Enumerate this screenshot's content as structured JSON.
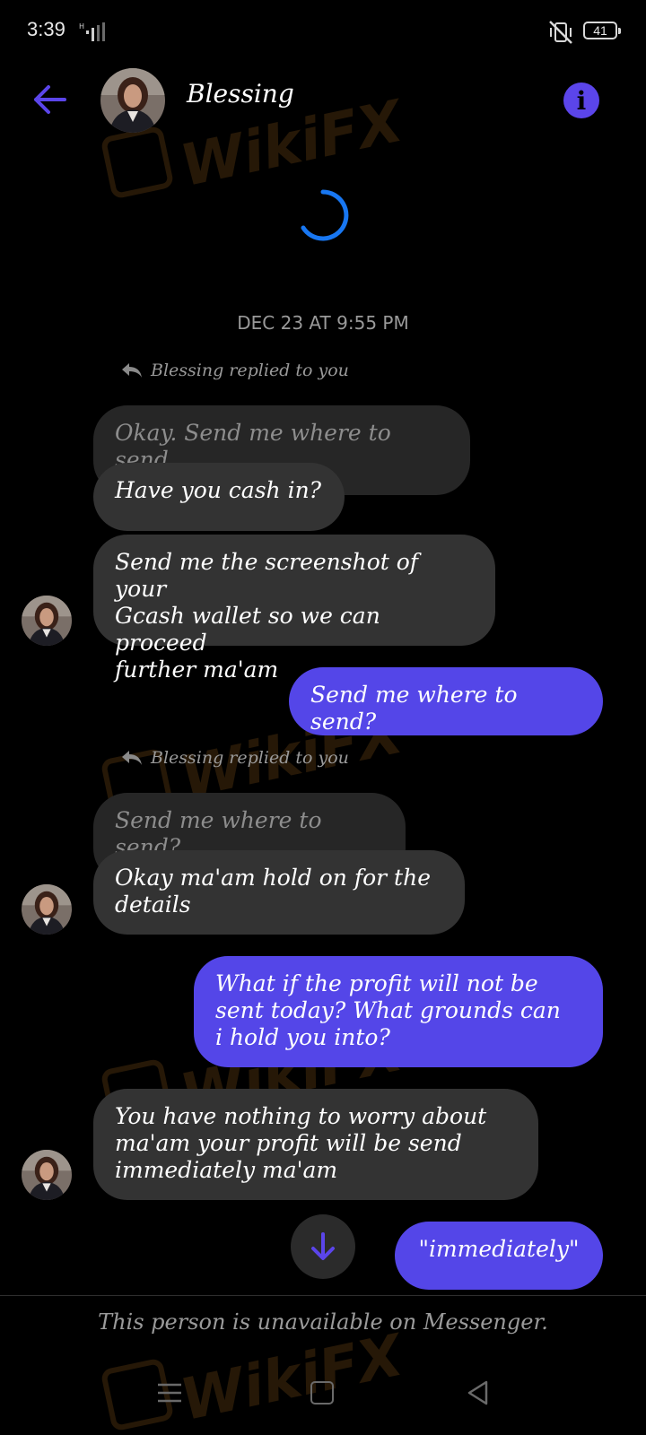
{
  "status_bar": {
    "time": "3:39",
    "battery": "41"
  },
  "header": {
    "contact_name": "Blessing"
  },
  "conversation": {
    "timestamp": "DEC 23 AT 9:55 PM",
    "reply_note_1": "Blessing replied to you",
    "quoted_1": "Okay. Send me where to send.",
    "in_1": "Have you cash in?",
    "in_2": "Send me the screenshot of your\nGcash wallet so we can proceed\nfurther ma'am",
    "out_1": "Send me where to send?",
    "reply_note_2": "Blessing replied to you",
    "quoted_2": "Send me where to send?",
    "in_3": "Okay ma'am hold on for the\ndetails",
    "out_2": "What if the profit will not be\nsent today? What grounds can\ni hold you into?",
    "in_4": "You have nothing to worry about\nma'am your profit will be send\nimmediately ma'am",
    "out_3": "\"immediately\""
  },
  "footer": {
    "unavailable_text": "This person is unavailable on Messenger."
  },
  "watermark": {
    "text": "WikiFX"
  },
  "colors": {
    "accent": "#5446e8",
    "incoming_bubble": "#333333",
    "quoted_bubble": "#262626",
    "spinner": "#1877f2"
  }
}
